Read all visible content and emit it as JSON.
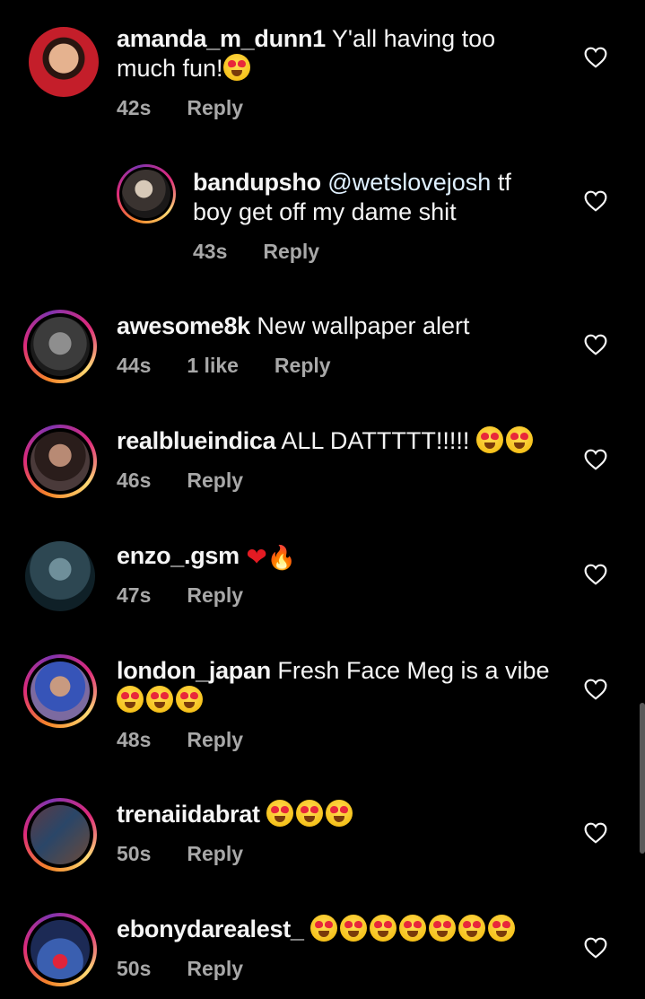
{
  "reply_label": "Reply",
  "comments": [
    {
      "user": "amanda_m_dunn1",
      "text": "Y'all having too much fun!",
      "emoji_count": 1,
      "time": "42s"
    },
    {
      "user": "bandupsho",
      "mention": "@wetslovejosh",
      "text": "tf boy get off my dame shit",
      "time": "43s"
    },
    {
      "user": "awesome8k",
      "text": "New wallpaper alert",
      "time": "44s",
      "likes": "1 like"
    },
    {
      "user": "realblueindica",
      "text": "ALL DATTTTT!!!!!",
      "emoji_count": 2,
      "time": "46s"
    },
    {
      "user": "enzo_.gsm",
      "text": "",
      "icons": [
        "red-heart-icon",
        "fire-icon"
      ],
      "heart_glyph": "❤",
      "fire_glyph": "🔥",
      "time": "47s"
    },
    {
      "user": "london_japan",
      "text": "Fresh Face Meg is a vibe",
      "emoji_count": 3,
      "time": "48s"
    },
    {
      "user": "trenaiidabrat",
      "text": "",
      "emoji_count": 3,
      "time": "50s"
    },
    {
      "user": "ebonydarealest_",
      "text": "",
      "emoji_count": 7,
      "time": "50s"
    }
  ],
  "colors": {
    "background": "#000000",
    "text": "#f5f5f5",
    "meta": "#a8a8a8",
    "ring_gradient": [
      "#f58529",
      "#dd2a7b",
      "#8134af"
    ]
  }
}
